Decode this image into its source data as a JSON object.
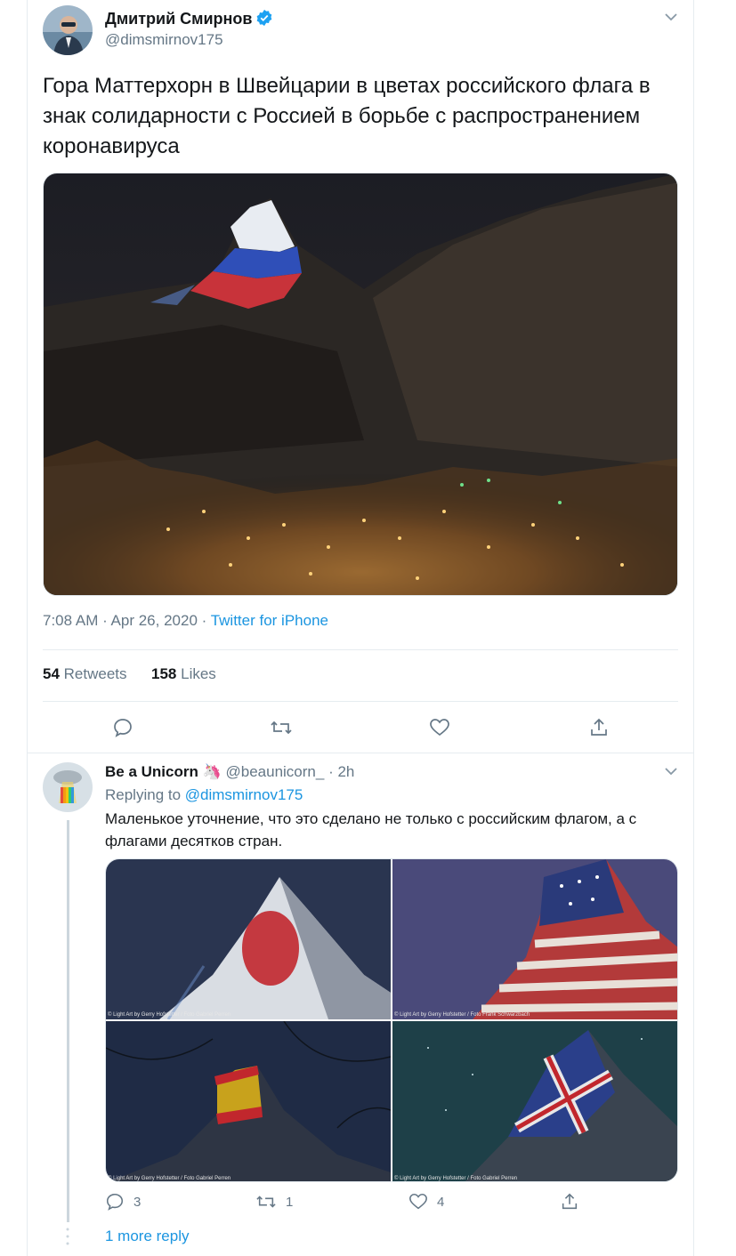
{
  "tweet": {
    "author_name": "Дмитрий Смирнов",
    "author_handle": "@dimsmirnov175",
    "text": "Гора Маттерхорн в Швейцарии в цветах российского флага в знак солидарности с Россией в борьбе с распространением коронавируса",
    "time": "7:08 AM · Apr 26, 2020 · ",
    "source": "Twitter for iPhone",
    "retweets_count": "54",
    "retweets_label": "Retweets",
    "likes_count": "158",
    "likes_label": "Likes",
    "actions": [
      "reply-icon",
      "retweet-icon",
      "like-icon",
      "share-icon"
    ]
  },
  "reply": {
    "author_name": "Be a Unicorn",
    "author_emoji": "🦄",
    "author_handle": "@beaunicorn_",
    "separator": " · ",
    "time": "2h",
    "replying_prefix": "Replying to ",
    "replying_to": "@dimsmirnov175",
    "text": "Маленькое уточнение, что это сделано не только с российским флагом, а с флагами десятков стран.",
    "photo_credits": [
      "© Light Art by Gerry Hofstetter / Foto Gabriel Perren",
      "© Light Art by Gerry Hofstetter / Foto Frank Schwarzbach",
      "© Light Art by Gerry Hofstetter / Foto Gabriel Perren",
      "© Light Art by Gerry Hofstetter / Foto Gabriel Perren"
    ],
    "reply_count": "3",
    "retweet_count": "1",
    "like_count": "4"
  },
  "more_replies": "1 more reply",
  "colors": {
    "link": "#1b95e0",
    "muted": "#657786",
    "divider": "#e6ecf0"
  }
}
